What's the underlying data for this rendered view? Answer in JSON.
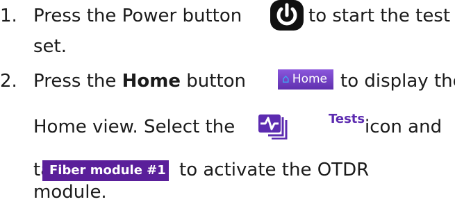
{
  "steps": [
    {
      "number": "1.",
      "line1_before": "Press the Power button",
      "line1_after": "to start the test",
      "line2": "set."
    },
    {
      "number": "2.",
      "line1_prefix": "Press the",
      "line1_bold": "Home",
      "line1_mid": "button",
      "line1_after": "to display the",
      "line2_before": "Home view. Select the",
      "line2_after": "icon and",
      "line3_before": "tap",
      "line3_after": "to activate the OTDR",
      "line4": "module."
    }
  ],
  "buttons": {
    "home_label": "Home",
    "tests_label": "Tests",
    "fiber_label": "Fiber module #1"
  },
  "colors": {
    "accent_purple": "#5a1f9a",
    "home_gradient_top": "#8b57dc",
    "home_icon": "#3fa9f5",
    "tests_text": "#5c2bb0"
  },
  "icons": [
    "power-icon",
    "home-icon",
    "tests-icon"
  ]
}
